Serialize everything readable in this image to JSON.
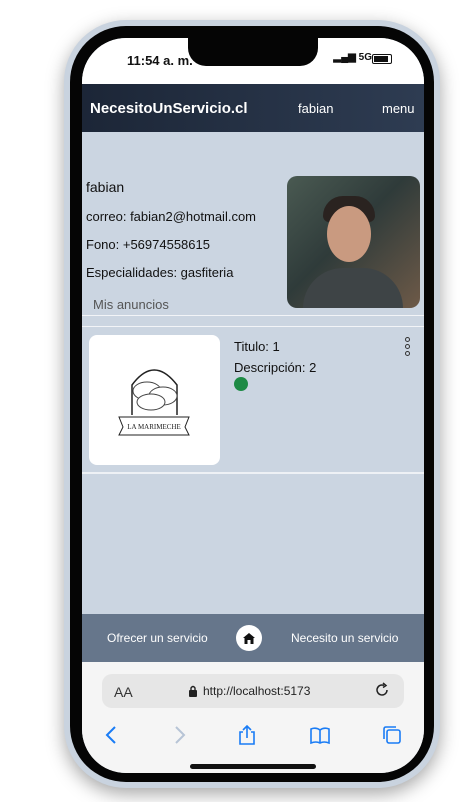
{
  "status": {
    "time": "11:54 a. m.",
    "signal": "5G"
  },
  "navbar": {
    "brand": "NecesitoUnServicio.cl",
    "user": "fabian",
    "menu": "menu"
  },
  "profile": {
    "name": "fabian",
    "email": "correo: fabian2@hotmail.com",
    "phone": "Fono: +56974558615",
    "specialties": "Especialidades: gasfiteria",
    "section_label": "Mis anuncios"
  },
  "ad": {
    "title": "Titulo: 1",
    "description": "Descripción: 2",
    "status_color": "#1d8a45",
    "logo_text": "LA MARIMECHE"
  },
  "bottom_nav": {
    "left": "Ofrecer un servicio",
    "right": "Necesito un servicio",
    "home_icon": "home-icon"
  },
  "browser": {
    "aa": "AA",
    "url": "http://localhost:5173"
  },
  "colors": {
    "navbar": "#1c2637",
    "content_bg": "#cbd5e1",
    "bottom_bar": "#66768b",
    "ios_blue": "#1a7cf5"
  }
}
